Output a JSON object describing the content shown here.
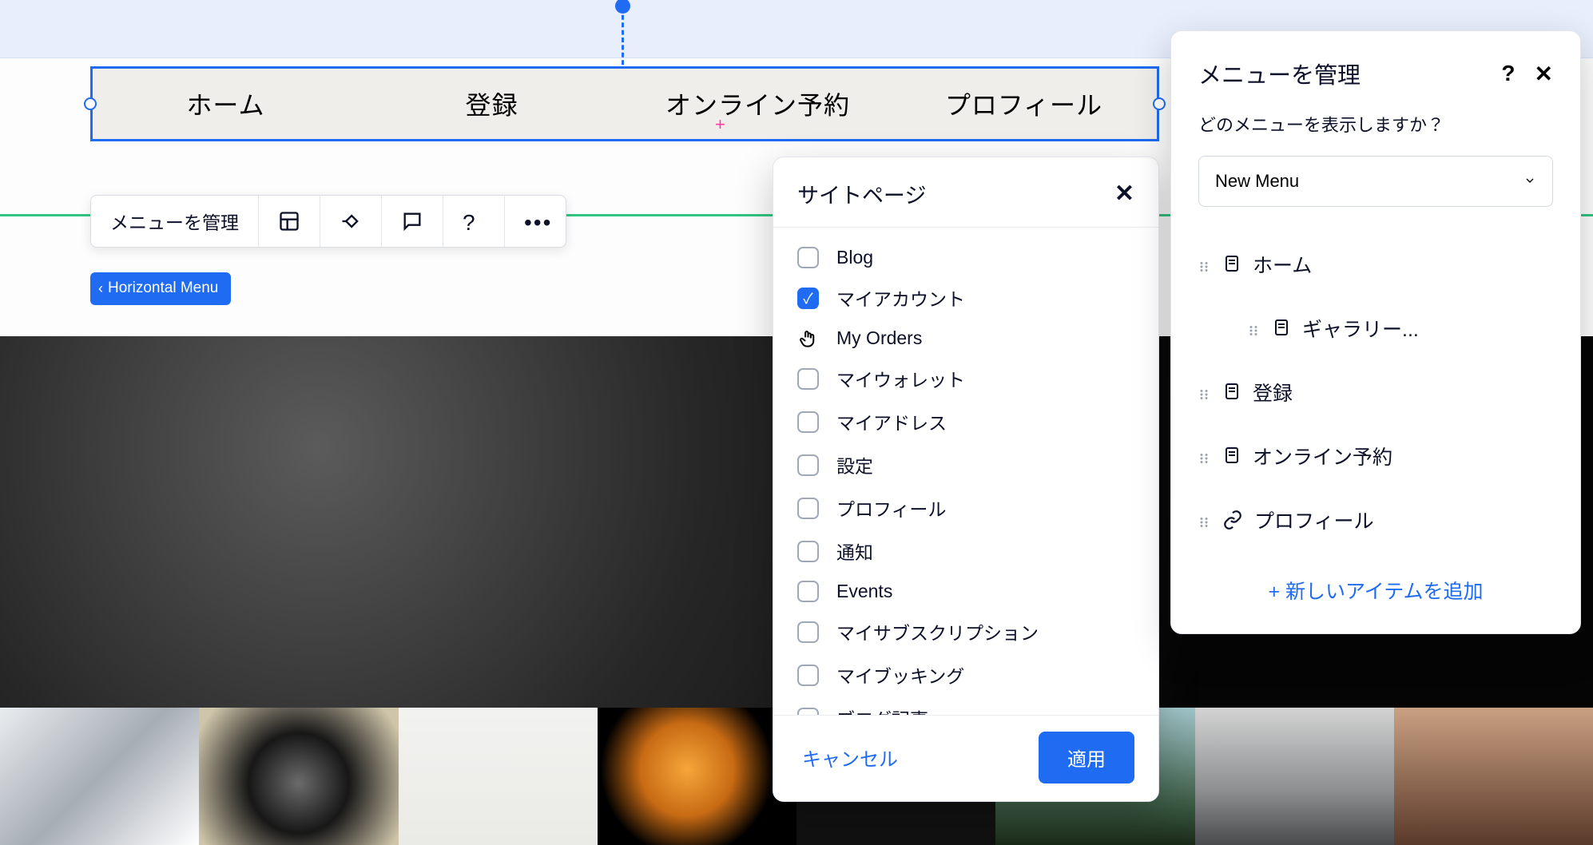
{
  "nav": {
    "items": [
      "ホーム",
      "登録",
      "オンライン予約",
      "プロフィール"
    ]
  },
  "float_toolbar": {
    "manage_label": "メニューを管理"
  },
  "breadcrumb": {
    "label": "Horizontal Menu"
  },
  "modal_pages": {
    "title": "サイトページ",
    "items": [
      {
        "label": "Blog",
        "checked": false
      },
      {
        "label": "マイアカウント",
        "checked": true
      },
      {
        "label": "My Orders",
        "checked": false,
        "hover": true
      },
      {
        "label": "マイウォレット",
        "checked": false
      },
      {
        "label": "マイアドレス",
        "checked": false
      },
      {
        "label": "設定",
        "checked": false
      },
      {
        "label": "プロフィール",
        "checked": false
      },
      {
        "label": "通知",
        "checked": false
      },
      {
        "label": "Events",
        "checked": false
      },
      {
        "label": "マイサブスクリプション",
        "checked": false
      },
      {
        "label": "マイブッキング",
        "checked": false
      },
      {
        "label": "ブログ記事",
        "checked": false
      }
    ],
    "cancel_label": "キャンセル",
    "apply_label": "適用"
  },
  "panel_manage": {
    "title": "メニューを管理",
    "subtitle": "どのメニューを表示しますか？",
    "select_value": "New Menu",
    "items": [
      {
        "label": "ホーム",
        "icon": "page",
        "indent": false
      },
      {
        "label": "ギャラリー...",
        "icon": "page",
        "indent": true
      },
      {
        "label": "登録",
        "icon": "page",
        "indent": false
      },
      {
        "label": "オンライン予約",
        "icon": "page",
        "indent": false
      },
      {
        "label": "プロフィール",
        "icon": "link",
        "indent": false
      }
    ],
    "add_label": "+ 新しいアイテムを追加"
  }
}
